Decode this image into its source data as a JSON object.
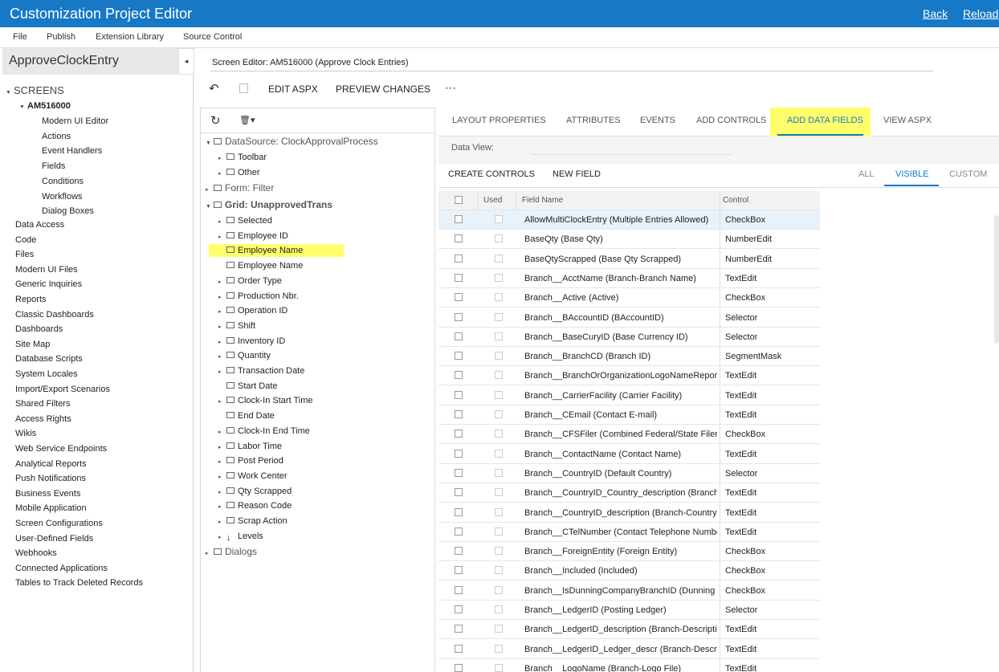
{
  "app": {
    "title": "Customization Project Editor",
    "back": "Back",
    "reload": "Reload"
  },
  "menu": [
    "File",
    "Publish",
    "Extension Library",
    "Source Control"
  ],
  "project": {
    "name": "ApproveClockEntry",
    "collapse_glyph": "◂"
  },
  "sidebar": {
    "screens_label": "SCREENS",
    "screen_id": "AM516000",
    "screen_items": [
      "Modern UI Editor",
      "Actions",
      "Event Handlers",
      "Fields",
      "Conditions",
      "Workflows",
      "Dialog Boxes"
    ],
    "items": [
      "Data Access",
      "Code",
      "Files",
      "Modern UI Files",
      "Generic Inquiries",
      "Reports",
      "Classic Dashboards",
      "Dashboards",
      "Site Map",
      "Database Scripts",
      "System Locales",
      "Import/Export Scenarios",
      "Shared Filters",
      "Access Rights",
      "Wikis",
      "Web Service Endpoints",
      "Analytical Reports",
      "Push Notifications",
      "Business Events",
      "Mobile Application",
      "Screen Configurations",
      "User-Defined Fields",
      "Webhooks",
      "Connected Applications",
      "Tables to Track Deleted Records"
    ]
  },
  "editor": {
    "heading": "Screen Editor: AM516000 (Approve Clock Entries)",
    "undo_glyph": "↶",
    "save_glyph": "▭",
    "edit_aspx": "EDIT ASPX",
    "preview": "PREVIEW CHANGES",
    "more": "⋯"
  },
  "tree": {
    "refresh_glyph": "↻",
    "delete_glyph": "🗑▾",
    "datasource": "DataSource: ClockApprovalProcess",
    "ds_children": [
      "Toolbar",
      "Other"
    ],
    "form": "Form: Filter",
    "grid": "Grid: UnapprovedTrans",
    "grid_children": [
      "Selected",
      "Employee ID",
      "Employee Name",
      "Employee Name",
      "Order Type",
      "Production Nbr.",
      "Operation ID",
      "Shift",
      "Inventory ID",
      "Quantity",
      "Transaction Date",
      "Start Date",
      "Clock-In Start Time",
      "End Date",
      "Clock-In End Time",
      "Labor Time",
      "Post Period",
      "Work Center",
      "Qty Scrapped",
      "Reason Code",
      "Scrap Action",
      "Levels"
    ],
    "dialogs": "Dialogs"
  },
  "tabs": [
    "LAYOUT PROPERTIES",
    "ATTRIBUTES",
    "EVENTS",
    "ADD CONTROLS",
    "ADD DATA FIELDS",
    "VIEW ASPX"
  ],
  "dataview_label": "Data View:",
  "actions": {
    "create": "CREATE CONTROLS",
    "newfield": "NEW FIELD"
  },
  "filters": [
    "ALL",
    "VISIBLE",
    "CUSTOM"
  ],
  "grid": {
    "headers": {
      "used": "Used",
      "field": "Field Name",
      "control": "Control"
    },
    "rows": [
      [
        "AllowMultiClockEntry (Multiple Entries Allowed)",
        "CheckBox"
      ],
      [
        "BaseQty (Base Qty)",
        "NumberEdit"
      ],
      [
        "BaseQtyScrapped (Base Qty Scrapped)",
        "NumberEdit"
      ],
      [
        "Branch__AcctName (Branch-Branch Name)",
        "TextEdit"
      ],
      [
        "Branch__Active (Active)",
        "CheckBox"
      ],
      [
        "Branch__BAccountID (BAccountID)",
        "Selector"
      ],
      [
        "Branch__BaseCuryID (Base Currency ID)",
        "Selector"
      ],
      [
        "Branch__BranchCD (Branch ID)",
        "SegmentMask"
      ],
      [
        "Branch__BranchOrOrganizationLogoNameReport",
        "TextEdit"
      ],
      [
        "Branch__CarrierFacility (Carrier Facility)",
        "TextEdit"
      ],
      [
        "Branch__CEmail (Contact E-mail)",
        "TextEdit"
      ],
      [
        "Branch__CFSFiler (Combined Federal/State Filer)",
        "CheckBox"
      ],
      [
        "Branch__ContactName (Contact Name)",
        "TextEdit"
      ],
      [
        "Branch__CountryID (Default Country)",
        "Selector"
      ],
      [
        "Branch__CountryID_Country_description (Branch-",
        "TextEdit"
      ],
      [
        "Branch__CountryID_description (Branch-Country N",
        "TextEdit"
      ],
      [
        "Branch__CTelNumber (Contact Telephone Number",
        "TextEdit"
      ],
      [
        "Branch__ForeignEntity (Foreign Entity)",
        "CheckBox"
      ],
      [
        "Branch__Included (Included)",
        "CheckBox"
      ],
      [
        "Branch__IsDunningCompanyBranchID (Dunning L",
        "CheckBox"
      ],
      [
        "Branch__LedgerID (Posting Ledger)",
        "Selector"
      ],
      [
        "Branch__LedgerID_description (Branch-Descriptio",
        "TextEdit"
      ],
      [
        "Branch__LedgerID_Ledger_descr (Branch-Descript",
        "TextEdit"
      ],
      [
        "Branch__LogoName (Branch-Logo File)",
        "TextEdit"
      ]
    ]
  },
  "colors": {
    "accent": "#1778c6",
    "highlight": "#ffff6b"
  }
}
